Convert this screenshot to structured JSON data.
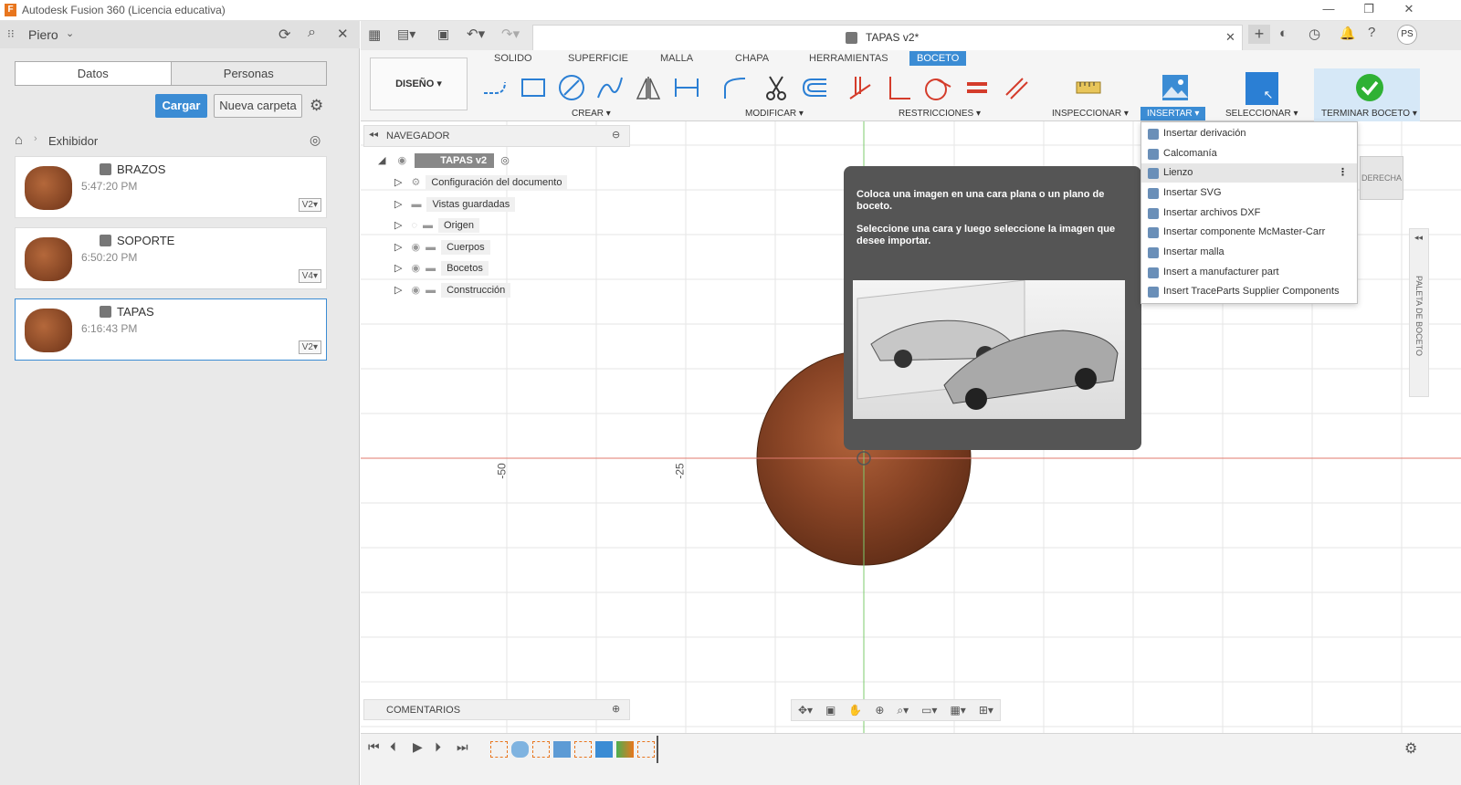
{
  "window": {
    "title": "Autodesk Fusion 360 (Licencia educativa)"
  },
  "left_panel": {
    "user": "Piero",
    "tabs": [
      "Datos",
      "Personas"
    ],
    "upload_label": "Cargar",
    "new_folder_label": "Nueva carpeta",
    "breadcrumb": "Exhibidor",
    "files": [
      {
        "name": "BRAZOS",
        "time": "5:47:20 PM",
        "version": "V2▾"
      },
      {
        "name": "SOPORTE",
        "time": "6:50:20 PM",
        "version": "V4▾"
      },
      {
        "name": "TAPAS",
        "time": "6:16:43 PM",
        "version": "V2▾"
      }
    ]
  },
  "document": {
    "tab_title": "TAPAS v2*",
    "user_initials": "PS"
  },
  "toolbar": {
    "tabs": [
      "SOLIDO",
      "SUPERFICIE",
      "MALLA",
      "CHAPA",
      "HERRAMIENTAS",
      "BOCETO"
    ],
    "workspace": "DISEÑO ▾",
    "groups": {
      "crear": "CREAR ▾",
      "modificar": "MODIFICAR ▾",
      "restricciones": "RESTRICCIONES ▾",
      "inspeccionar": "INSPECCIONAR ▾",
      "insertar": "INSERTAR ▾",
      "seleccionar": "SELECCIONAR ▾",
      "terminar": "TERMINAR BOCETO ▾"
    }
  },
  "navigator": {
    "title": "NAVEGADOR",
    "root": "TAPAS v2",
    "items": [
      "Configuración del documento",
      "Vistas guardadas",
      "Origen",
      "Cuerpos",
      "Bocetos",
      "Construcción"
    ]
  },
  "tooltip": {
    "line1": "Coloca una imagen en una cara plana o un plano de boceto.",
    "line2": "Seleccione una cara y luego seleccione la imagen que desee importar."
  },
  "insert_menu": {
    "items": [
      "Insertar derivación",
      "Calcomanía",
      "Lienzo",
      "Insertar SVG",
      "Insertar archivos DXF",
      "Insertar componente McMaster-Carr",
      "Insertar malla",
      "Insert a manufacturer part",
      "Insert TraceParts Supplier Components"
    ]
  },
  "canvas": {
    "axis_labels": [
      "-50",
      "-25"
    ],
    "viewcube": "DERECHA",
    "palette": "PALETA DE BOCETO"
  },
  "comments": {
    "label": "COMENTARIOS"
  }
}
